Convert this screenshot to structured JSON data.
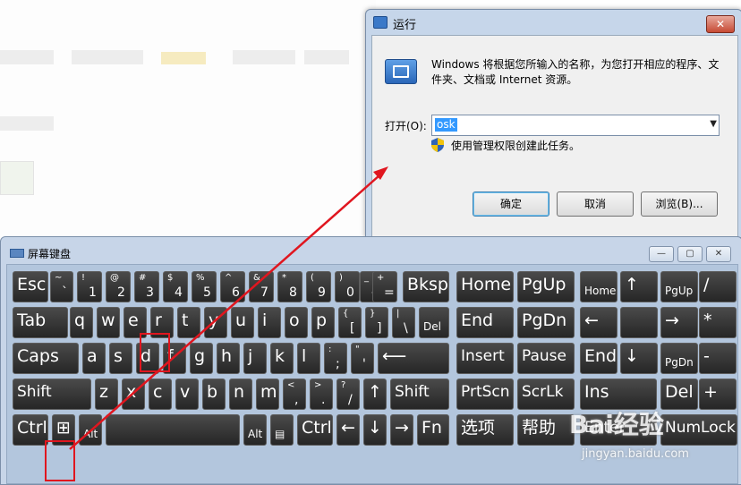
{
  "run_dialog": {
    "title": "运行",
    "close": "✕",
    "description": "Windows 将根据您所输入的名称，为您打开相应的程序、文件夹、文档或 Internet 资源。",
    "open_label": "打开(O):",
    "open_value": "osk",
    "admin_note": "使用管理权限创建此任务。",
    "ok": "确定",
    "cancel": "取消",
    "browse": "浏览(B)..."
  },
  "osk": {
    "title": "屏幕键盘",
    "minimize": "—",
    "restore": "▢",
    "close": "✕"
  },
  "keys": [
    {
      "m": "Esc"
    },
    {
      "sh": "~",
      "lo": "`"
    },
    {
      "sh": "!",
      "lo": "1"
    },
    {
      "sh": "@",
      "lo": "2"
    },
    {
      "sh": "#",
      "lo": "3"
    },
    {
      "sh": "$",
      "lo": "4"
    },
    {
      "sh": "%",
      "lo": "5"
    },
    {
      "sh": "^",
      "lo": "6"
    },
    {
      "sh": "&",
      "lo": "7"
    },
    {
      "sh": "*",
      "lo": "8"
    },
    {
      "sh": "(",
      "lo": "9"
    },
    {
      "sh": ")",
      "lo": "0"
    },
    {
      "sh": "_",
      "lo": "-"
    },
    {
      "sh": "+",
      "lo": "="
    },
    {
      "m": "Bksp"
    },
    {
      "m": "Home"
    },
    {
      "m": "PgUp"
    },
    {
      "m": "Home",
      "sm": true
    },
    {
      "m": "↑"
    },
    {
      "m": "PgUp",
      "sm": true
    },
    {
      "m": "/"
    },
    {
      "m": "Tab"
    },
    {
      "m": "q"
    },
    {
      "m": "w"
    },
    {
      "m": "e"
    },
    {
      "m": "r"
    },
    {
      "m": "t"
    },
    {
      "m": "y"
    },
    {
      "m": "u"
    },
    {
      "m": "i"
    },
    {
      "m": "o"
    },
    {
      "m": "p"
    },
    {
      "sh": "{",
      "lo": "["
    },
    {
      "sh": "}",
      "lo": "]"
    },
    {
      "sh": "|",
      "lo": "\\"
    },
    {
      "m": "Del",
      "sm": true
    },
    {
      "m": "End"
    },
    {
      "m": "PgDn"
    },
    {
      "m": "←"
    },
    {
      "m": ""
    },
    {
      "m": "→"
    },
    {
      "m": "*"
    },
    {
      "m": "Caps"
    },
    {
      "m": "a"
    },
    {
      "m": "s"
    },
    {
      "m": "d"
    },
    {
      "m": "f"
    },
    {
      "m": "g"
    },
    {
      "m": "h"
    },
    {
      "m": "j"
    },
    {
      "m": "k"
    },
    {
      "m": "l"
    },
    {
      "sh": ":",
      "lo": ";"
    },
    {
      "sh": "\"",
      "lo": "'"
    },
    {
      "m": "⟵"
    },
    {
      "m": "Insert"
    },
    {
      "m": "Pause"
    },
    {
      "m": "End"
    },
    {
      "m": "↓"
    },
    {
      "m": "PgDn",
      "sm": true
    },
    {
      "m": "-"
    },
    {
      "m": "Shift"
    },
    {
      "m": "z"
    },
    {
      "m": "x"
    },
    {
      "m": "c"
    },
    {
      "m": "v"
    },
    {
      "m": "b"
    },
    {
      "m": "n"
    },
    {
      "m": "m"
    },
    {
      "sh": "<",
      "lo": ","
    },
    {
      "sh": ">",
      "lo": "."
    },
    {
      "sh": "?",
      "lo": "/"
    },
    {
      "m": "↑"
    },
    {
      "m": "Shift"
    },
    {
      "m": "PrtScn"
    },
    {
      "m": "ScrLk"
    },
    {
      "m": "Ins"
    },
    {
      "m": "Del"
    },
    {
      "m": "+"
    },
    {
      "m": "Ctrl"
    },
    {
      "m": "⊞"
    },
    {
      "m": "Alt",
      "sm": true
    },
    {
      "m": ""
    },
    {
      "m": "Alt",
      "sm": true
    },
    {
      "m": "▤",
      "sm": true
    },
    {
      "m": "Ctrl"
    },
    {
      "m": "←"
    },
    {
      "m": "↓"
    },
    {
      "m": "→"
    },
    {
      "m": "Fn"
    },
    {
      "m": "选项"
    },
    {
      "m": "帮助"
    },
    {
      "m": "Enter"
    },
    {
      "m": "NumLock"
    }
  ],
  "watermark": {
    "brand": "Bai经验",
    "url": "jingyan.baidu.com"
  },
  "colors": {
    "annotation_red": "#e0161f",
    "key_bg": "#2f2f2f",
    "selection": "#3399ff"
  }
}
